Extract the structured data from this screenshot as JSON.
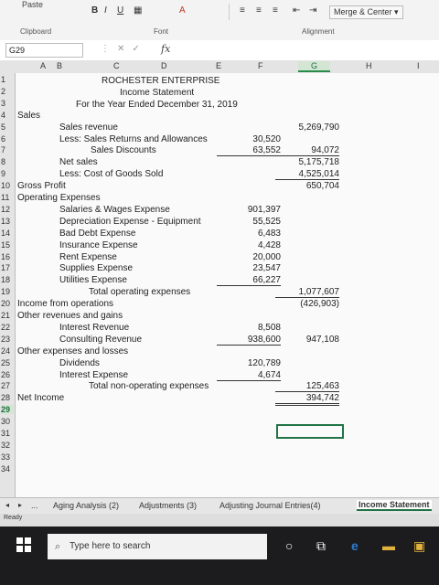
{
  "ribbon": {
    "paste": "Paste",
    "bold": "B",
    "italic": "I",
    "underline": "U",
    "merge_center": "Merge & Center",
    "groups": {
      "clipboard": "Clipboard",
      "font": "Font",
      "alignment": "Alignment"
    }
  },
  "formula_bar": {
    "name_box": "G29",
    "fx": "fx"
  },
  "columns": [
    "A",
    "B",
    "C",
    "D",
    "E",
    "F",
    "G",
    "H",
    "I"
  ],
  "selected_column": "G",
  "selected_row": "29",
  "rows": [
    "1",
    "2",
    "3",
    "4",
    "5",
    "6",
    "7",
    "8",
    "9",
    "10",
    "11",
    "12",
    "13",
    "14",
    "15",
    "16",
    "17",
    "18",
    "19",
    "20",
    "21",
    "22",
    "23",
    "24",
    "25",
    "26",
    "27",
    "28",
    "29",
    "30",
    "31",
    "32",
    "33",
    "34"
  ],
  "sheet": {
    "title1": "ROCHESTER ENTERPRISE",
    "title2": "Income Statement",
    "title3": "For the Year Ended December 31, 2019",
    "lines": [
      {
        "row": 4,
        "col": "A",
        "text": "Sales"
      },
      {
        "row": 5,
        "col": "B",
        "text": "Sales revenue"
      },
      {
        "row": 6,
        "col": "B",
        "text": "Less:  Sales Returns and Allowances"
      },
      {
        "row": 7,
        "col": "B2",
        "text": "Sales Discounts"
      },
      {
        "row": 8,
        "col": "B1",
        "text": "Net sales"
      },
      {
        "row": 9,
        "col": "B1",
        "text": "Less:  Cost of Goods Sold"
      },
      {
        "row": 10,
        "col": "A",
        "text": "Gross Profit"
      },
      {
        "row": 11,
        "col": "A",
        "text": "Operating Expenses"
      },
      {
        "row": 12,
        "col": "B",
        "text": "Salaries & Wages Expense"
      },
      {
        "row": 13,
        "col": "B",
        "text": "Depreciation Expense - Equipment"
      },
      {
        "row": 14,
        "col": "B",
        "text": "Bad Debt Expense"
      },
      {
        "row": 15,
        "col": "B",
        "text": "Insurance Expense"
      },
      {
        "row": 16,
        "col": "B",
        "text": "Rent Expense"
      },
      {
        "row": 17,
        "col": "B",
        "text": "Supplies Expense"
      },
      {
        "row": 18,
        "col": "B",
        "text": "Utilities Expense"
      },
      {
        "row": 19,
        "col": "C",
        "text": "Total operating expenses"
      },
      {
        "row": 20,
        "col": "A",
        "text": "Income from operations"
      },
      {
        "row": 21,
        "col": "A",
        "text": "Other revenues and gains"
      },
      {
        "row": 22,
        "col": "B",
        "text": "Interest Revenue"
      },
      {
        "row": 23,
        "col": "B",
        "text": "Consulting Revenue"
      },
      {
        "row": 24,
        "col": "A",
        "text": "Other expenses and losses"
      },
      {
        "row": 25,
        "col": "B",
        "text": "Dividends"
      },
      {
        "row": 26,
        "col": "B",
        "text": "Interest Expense"
      },
      {
        "row": 27,
        "col": "C",
        "text": "Total non-operating expenses"
      },
      {
        "row": 28,
        "col": "A",
        "text": "Net Income"
      }
    ],
    "col_f": [
      {
        "row": 6,
        "text": "30,520"
      },
      {
        "row": 7,
        "text": "63,552",
        "line": "ul"
      },
      {
        "row": 12,
        "text": "901,397"
      },
      {
        "row": 13,
        "text": "55,525"
      },
      {
        "row": 14,
        "text": "6,483"
      },
      {
        "row": 15,
        "text": "4,428"
      },
      {
        "row": 16,
        "text": "20,000"
      },
      {
        "row": 17,
        "text": "23,547"
      },
      {
        "row": 18,
        "text": "66,227",
        "line": "ul"
      },
      {
        "row": 22,
        "text": "8,508"
      },
      {
        "row": 23,
        "text": "938,600",
        "line": "ul"
      },
      {
        "row": 25,
        "text": "120,789"
      },
      {
        "row": 26,
        "text": "4,674",
        "line": "ul"
      }
    ],
    "col_g": [
      {
        "row": 5,
        "text": "5,269,790"
      },
      {
        "row": 7,
        "text": "94,072",
        "line": "ul"
      },
      {
        "row": 8,
        "text": "5,175,718"
      },
      {
        "row": 9,
        "text": "4,525,014",
        "line": "ul"
      },
      {
        "row": 10,
        "text": "650,704"
      },
      {
        "row": 19,
        "text": "1,077,607",
        "line": "ul"
      },
      {
        "row": 20,
        "text": "(426,903)"
      },
      {
        "row": 23,
        "text": "947,108"
      },
      {
        "row": 27,
        "text": "125,463",
        "line": "ul"
      },
      {
        "row": 28,
        "text": "394,742",
        "line": "dul"
      }
    ]
  },
  "tabs": {
    "ellipsis": "...",
    "items": [
      "Aging Analysis (2)",
      "Adjustments (3)",
      "Adjusting Journal Entries(4)",
      "Income Statement"
    ],
    "active": "Income Statement"
  },
  "status": "Ready",
  "taskbar": {
    "search_placeholder": "Type here to search"
  }
}
